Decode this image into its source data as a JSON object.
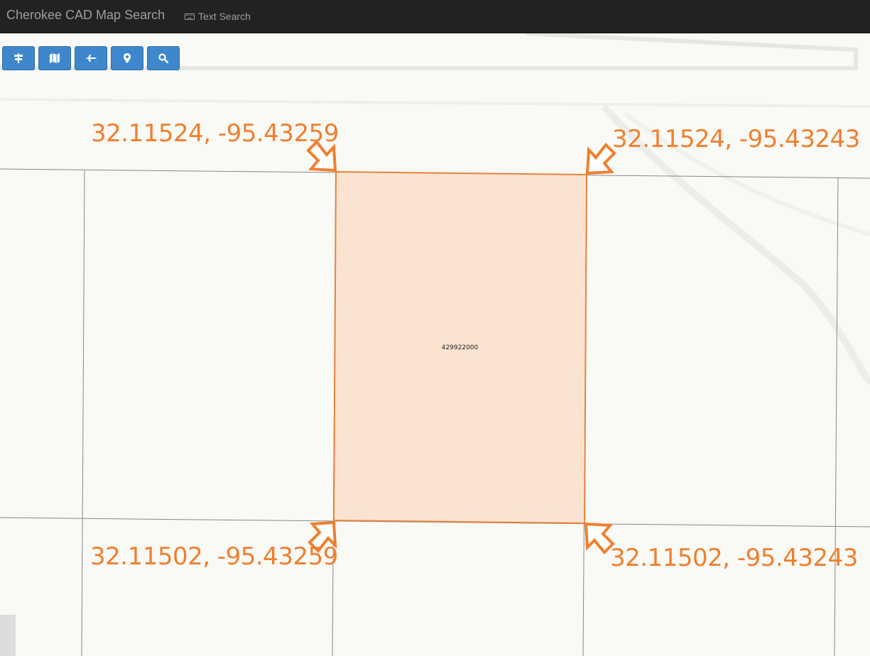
{
  "navbar": {
    "brand": "Cherokee CAD Map Search",
    "text_search_label": "Text Search"
  },
  "toolbar": {
    "buttons": [
      {
        "name": "layers-button",
        "icon": "road-sign-icon"
      },
      {
        "name": "basemap-button",
        "icon": "map-icon"
      },
      {
        "name": "plane-button",
        "icon": "plane-icon"
      },
      {
        "name": "location-button",
        "icon": "map-marker-icon"
      },
      {
        "name": "search-button",
        "icon": "search-icon"
      }
    ]
  },
  "map": {
    "parcel_id": "429922000",
    "highlight_fill": "#fbe3d2",
    "highlight_stroke": "#e8823c",
    "annotation_color": "#f07f2d",
    "corners": {
      "top_left": "32.11524, -95.43259",
      "top_right": "32.11524, -95.43243",
      "bottom_left": "32.11502, -95.43259",
      "bottom_right": "32.11502, -95.43243"
    }
  }
}
